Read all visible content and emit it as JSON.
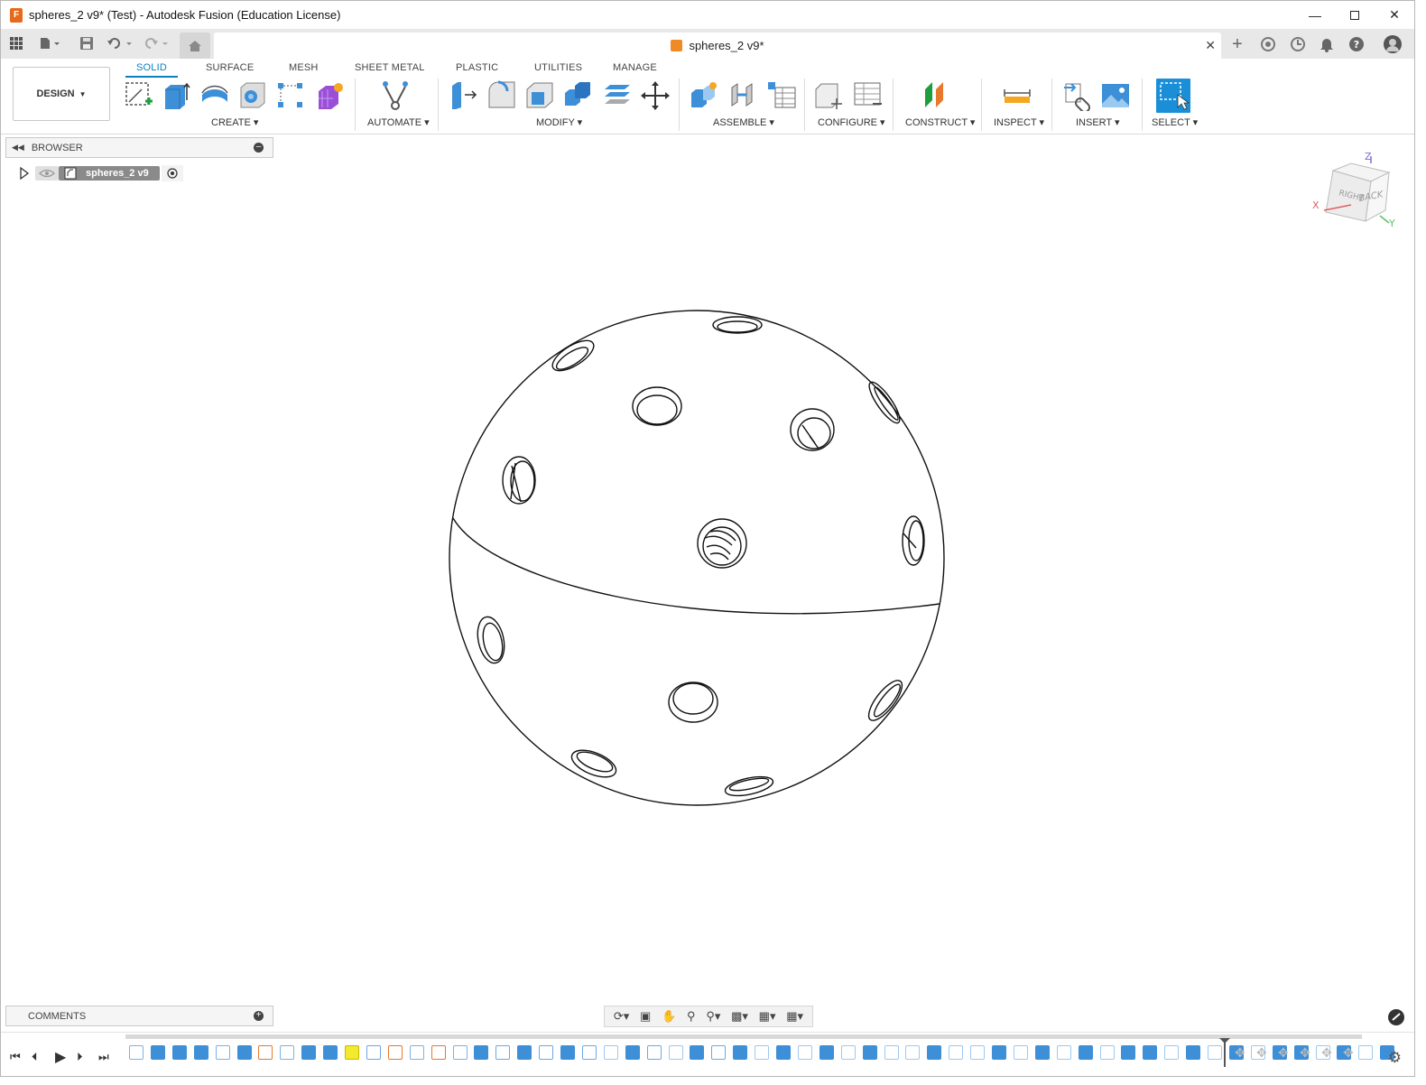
{
  "window": {
    "title": "spheres_2 v9* (Test) - Autodesk Fusion (Education License)",
    "app_icon_letter": "F",
    "controls": [
      "minimize-icon",
      "maximize-icon",
      "close-icon"
    ]
  },
  "tabbar": {
    "document_tab": "spheres_2 v9*",
    "left_icons": [
      "grid-icon",
      "file-icon",
      "save-icon",
      "undo-icon",
      "redo-icon",
      "home-icon"
    ],
    "right_icons": [
      "new-tab-icon",
      "sync-icon",
      "job-status-icon",
      "notification-icon",
      "help-icon",
      "avatar"
    ]
  },
  "toolbar": {
    "workspace": "DESIGN",
    "tabs": [
      "SOLID",
      "SURFACE",
      "MESH",
      "SHEET METAL",
      "PLASTIC",
      "UTILITIES",
      "MANAGE"
    ],
    "active_tab": "SOLID",
    "groups": [
      "CREATE",
      "AUTOMATE",
      "MODIFY",
      "ASSEMBLE",
      "CONFIGURE",
      "CONSTRUCT",
      "INSPECT",
      "INSERT",
      "SELECT"
    ]
  },
  "browser": {
    "title": "BROWSER",
    "root_node": "spheres_2 v9"
  },
  "comments": {
    "title": "COMMENTS"
  },
  "viewcube": {
    "face_right": "RIGHT",
    "face_back": "BACK",
    "axis_x": "X",
    "axis_y": "Y",
    "axis_z": "Z"
  },
  "colors": {
    "accent": "#0a7fc2",
    "select_blue": "#1a8fd8",
    "doc_icon": "#f08a24",
    "timeline_highlight": "#f3ea2e"
  }
}
